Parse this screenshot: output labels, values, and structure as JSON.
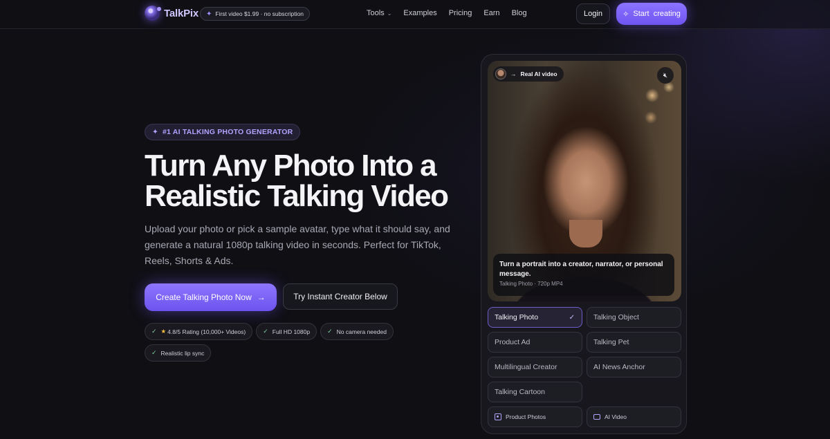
{
  "nav": {
    "brand": "TalkPix",
    "promo": "First video $1.99 · no subscription",
    "menu": [
      "Tools",
      "Examples",
      "Pricing",
      "Earn",
      "Blog"
    ],
    "login": "Login",
    "start": "Start  creating"
  },
  "hero": {
    "eyebrow": "#1 AI TALKING PHOTO GENERATOR",
    "title_line1": "Turn Any Photo Into a",
    "title_line2": "Realistic Talking Video",
    "subtitle": "Upload your photo or pick a sample avatar, type what it should say, and generate a natural 1080p talking video in seconds. Perfect for TikTok, Reels, Shorts & Ads.",
    "cta_primary": "Create Talking Photo Now",
    "cta_secondary": "Try Instant Creator Below",
    "badges": [
      "4.8/5 Rating (10,000+ Videos)",
      "Full HD 1080p",
      "No camera needed",
      "Realistic lip sync"
    ]
  },
  "preview": {
    "pill": "Real AI video",
    "caption_title": "Turn a portrait into a creator, narrator, or personal message.",
    "caption_meta": "Talking Photo · 720p MP4",
    "options": [
      "Talking Photo",
      "Talking Object",
      "Product Ad",
      "Talking Pet",
      "Multilingual Creator",
      "AI News Anchor",
      "Talking Cartoon"
    ],
    "selected": "Talking Photo",
    "extra": [
      "Product Photos",
      "AI Video"
    ]
  },
  "colors": {
    "accent": "#7c63f8",
    "background": "#0f0f14",
    "check": "#7fd3a2"
  }
}
